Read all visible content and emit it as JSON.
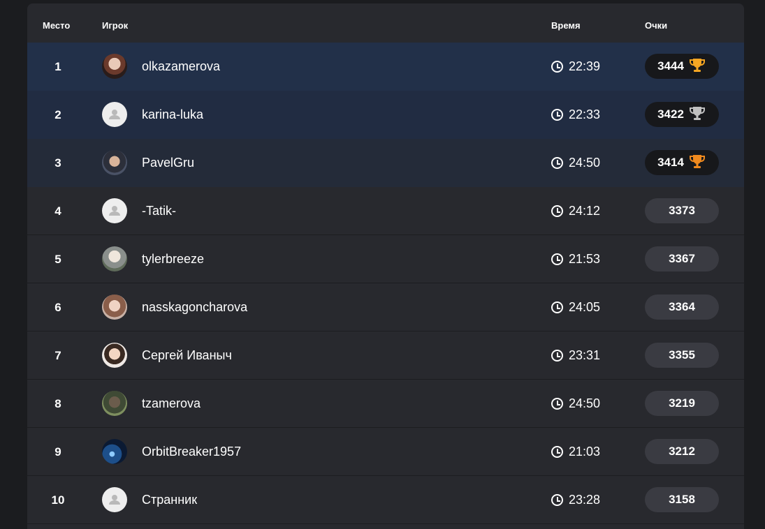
{
  "columns": {
    "place": "Место",
    "player": "Игрок",
    "time": "Время",
    "score": "Очки"
  },
  "colors": {
    "background": "#1b1c1f",
    "panel": "#28292e",
    "row1": "#223049",
    "row2": "#212c42",
    "row3": "#242b39",
    "gold": "#f5a623",
    "silver": "#c0c0c0",
    "bronze": "#f08a1e"
  },
  "rows": [
    {
      "place": "1",
      "player": "olkazamerova",
      "time": "22:39",
      "score": "3444",
      "avatar": "photo-avatar",
      "trophy": "gold-trophy-icon"
    },
    {
      "place": "2",
      "player": "karina-luka",
      "time": "22:33",
      "score": "3422",
      "avatar": "default-avatar",
      "trophy": "silver-trophy-icon"
    },
    {
      "place": "3",
      "player": "PavelGru",
      "time": "24:50",
      "score": "3414",
      "avatar": "photo-avatar",
      "trophy": "bronze-trophy-icon"
    },
    {
      "place": "4",
      "player": "-Tatik-",
      "time": "24:12",
      "score": "3373",
      "avatar": "default-avatar"
    },
    {
      "place": "5",
      "player": "tylerbreeze",
      "time": "21:53",
      "score": "3367",
      "avatar": "photo-avatar"
    },
    {
      "place": "6",
      "player": "nasskagoncharova",
      "time": "24:05",
      "score": "3364",
      "avatar": "photo-avatar"
    },
    {
      "place": "7",
      "player": "Сергей Иваныч",
      "time": "23:31",
      "score": "3355",
      "avatar": "photo-avatar"
    },
    {
      "place": "8",
      "player": "tzamerova",
      "time": "24:50",
      "score": "3219",
      "avatar": "photo-avatar"
    },
    {
      "place": "9",
      "player": "OrbitBreaker1957",
      "time": "21:03",
      "score": "3212",
      "avatar": "photo-avatar"
    },
    {
      "place": "10",
      "player": "Странник",
      "time": "23:28",
      "score": "3158",
      "avatar": "default-avatar"
    }
  ]
}
